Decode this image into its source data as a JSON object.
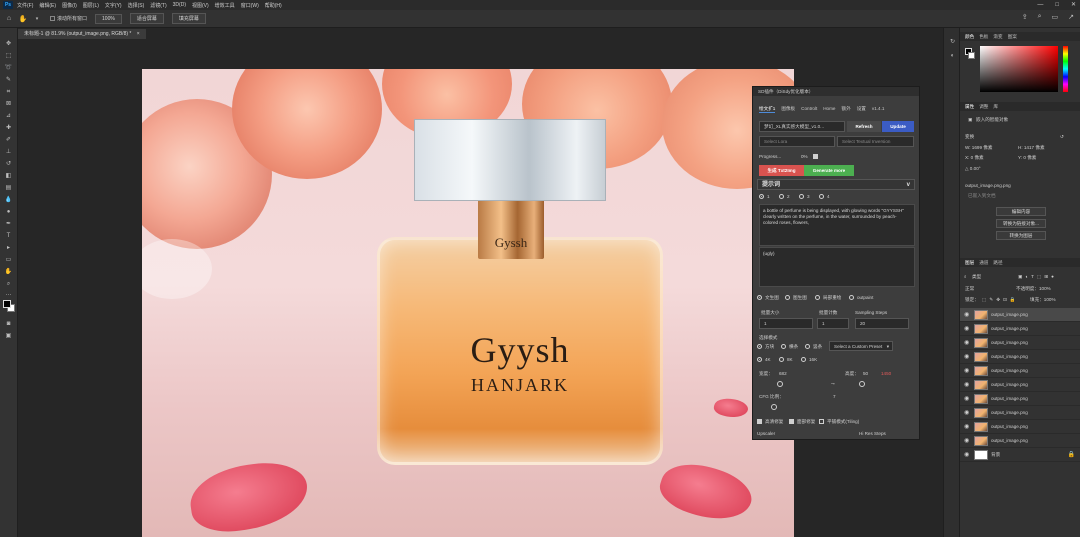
{
  "menubar": {
    "logo": "Ps",
    "items": [
      "文件(F)",
      "编辑(E)",
      "图像(I)",
      "图层(L)",
      "文字(Y)",
      "选择(S)",
      "滤镜(T)",
      "3D(D)",
      "视图(V)",
      "增效工具",
      "窗口(W)",
      "帮助(H)"
    ],
    "controls": [
      "—",
      "□",
      "✕"
    ]
  },
  "options_bar": {
    "checkbox_label": "滚动所有窗口",
    "zoom_button": "100%",
    "fit_button": "适合屏幕",
    "fill_button": "填充屏幕"
  },
  "document": {
    "tab_title": "未标题-1 @ 81.9% (output_image.png, RGB/8) *",
    "tab_close": "×"
  },
  "photo": {
    "neck_text": "Gyssh",
    "brand_text": "Gyysh",
    "sub_brand_text": "HANJARK"
  },
  "sd_panel": {
    "title": "SD插件（DiSdy优化版本）",
    "tabs": [
      "绘文扩1",
      "图像板",
      "Controlt",
      "Home",
      "额外",
      "设置"
    ],
    "version": "v1.4.1",
    "model_value": "梦幻_XL真实感大模型_v1.0...",
    "refresh_button": "Refresh",
    "update_button": "Update",
    "lora_placeholder": "Select Lora",
    "textual_inversion_placeholder": "Select Textual Inversion",
    "progress_label": "Progress...",
    "progress_value": "0%",
    "generate_button": "生成 Txt2Img",
    "generate_more_button": "Generate more",
    "prompt_header": "提示词",
    "prompt_header_caret": "v",
    "prompt_slots": [
      "1",
      "2",
      "3",
      "4"
    ],
    "prompt_text": "a bottle of perfume is being displayed, with glowing words \"GYYSSH\" clearly written on the perfume, in the water, surrounded by peach-colored roses, flowers,",
    "negative_text": "(ugly)",
    "modes": [
      "文生图",
      "图生图",
      "局部重绘",
      "outpaint"
    ],
    "batch_size_label": "批量大小",
    "batch_count_label": "批量计数",
    "sampling_steps_label": "Sampling Steps",
    "batch_size": "1",
    "batch_count": "1",
    "sampling_steps": "20",
    "select_mode_label": "选择模式",
    "mode_options": [
      "方块",
      "横条",
      "竖条"
    ],
    "preset_select": "Select a Custom Preset",
    "ratio_options": [
      "4K",
      "8K",
      "16K"
    ],
    "width_label": "宽度：",
    "width_value": "682",
    "height_label": "高度：",
    "height_value": "50",
    "height_extra": "1450",
    "cfg_label": "CFG 比例：",
    "cfg_value": "7",
    "options": [
      "高清修复",
      "面部修复",
      "平铺模式(Tiling)"
    ],
    "upscaler_label": "Upscaler",
    "hires_label": "Hi Res Steps"
  },
  "right_panels": {
    "color_tabs": [
      "颜色",
      "色板",
      "渐变",
      "图案"
    ],
    "props_tabs": [
      "属性",
      "调整",
      "库"
    ],
    "props_title": "嵌入的智能对象",
    "transform_label": "变换",
    "w_value": "W: 1699 像素",
    "h_value": "H: 1417 像素",
    "x_value": "X: 0 像素",
    "y_value": "Y: 0 像素",
    "angle_value": "△ 0.00°",
    "filename": "output_image.png.png",
    "embed_button": "已嵌入到文档",
    "edit_button": "编辑内容",
    "convert_button": "转换为链接对象...",
    "layers_convert_button": "转换为图层",
    "layers_tabs": [
      "图层",
      "通道",
      "路径"
    ],
    "kind_label": "类型",
    "blend_mode": "正常",
    "opacity_label": "不透明度：100%",
    "lock_label": "锁定：",
    "fill_label": "填充：100%",
    "layers": [
      "output_image.png",
      "output_image.png",
      "output_image.png",
      "output_image.png",
      "output_image.png",
      "output_image.png",
      "output_image.png",
      "output_image.png",
      "output_image.png",
      "output_image.png"
    ],
    "background_layer": "背景"
  },
  "colors": {
    "accent_blue": "#4d8bd9",
    "generate_red": "#d9534f",
    "generate_green": "#4caf50",
    "refresh_bg": "#4a4a4a",
    "update_bg": "#3b5cc4"
  }
}
